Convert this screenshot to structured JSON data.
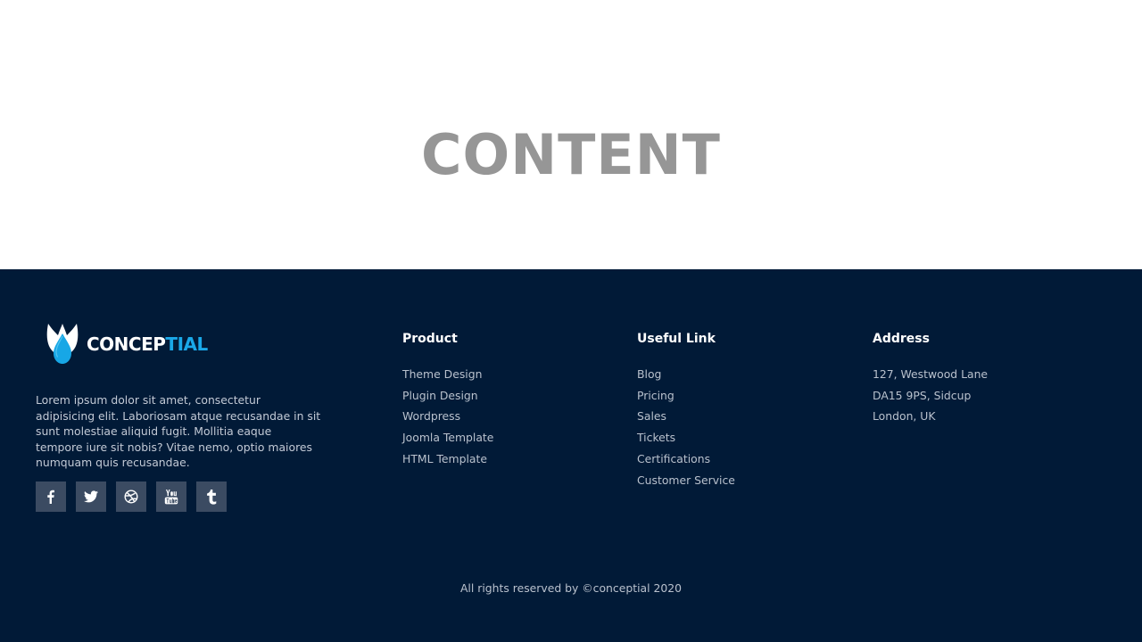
{
  "content": {
    "title": "CONTENT"
  },
  "footer": {
    "logo": {
      "text_white": "CONCEP",
      "text_blue": "TIAL"
    },
    "about": "Lorem ipsum dolor sit amet, consectetur adipisicing elit. Laboriosam atque recusandae in sit sunt molestiae aliquid fugit. Mollitia eaque tempore iure sit nobis? Vitae nemo, optio maiores numquam quis recusandae.",
    "socials": [
      {
        "icon": "facebook-icon"
      },
      {
        "icon": "twitter-icon"
      },
      {
        "icon": "dribbble-icon"
      },
      {
        "icon": "youtube-icon"
      },
      {
        "icon": "tumblr-icon"
      }
    ],
    "product": {
      "title": "Product",
      "links": [
        "Theme Design",
        "Plugin Design",
        "Wordpress",
        "Joomla Template",
        "HTML Template"
      ]
    },
    "useful": {
      "title": "Useful Link",
      "links": [
        "Blog",
        "Pricing",
        "Sales",
        "Tickets",
        "Certifications",
        "Customer Service"
      ]
    },
    "address": {
      "title": "Address",
      "lines": [
        "127, Westwood Lane",
        "DA15 9PS, Sidcup",
        "London, UK"
      ]
    },
    "copyright": "All rights reserved by ©conceptial 2020"
  },
  "colors": {
    "footer_bg": "#011a37",
    "brand_blue": "#1aa8e8",
    "content_text": "#969696",
    "social_bg": "#3b4b62"
  }
}
